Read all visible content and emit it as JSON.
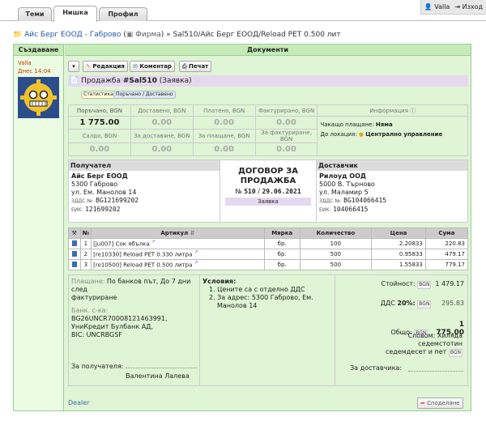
{
  "tabs": [
    "Теми",
    "Нишка",
    "Профил"
  ],
  "user": {
    "name": "Valla",
    "logout": "Изход"
  },
  "breadcrumb": {
    "company": "Айс Берг ЕООД - Габрово",
    "type": "Фирма",
    "doc": "Sal510/Айс Берг ЕООД/Reload PET 0.500 лит"
  },
  "headers": {
    "created": "Създаване",
    "documents": "Документи"
  },
  "creator": {
    "name": "Valla",
    "time": "Днес 14:04"
  },
  "toolbar": {
    "edit": "Редакция",
    "comment": "Коментар",
    "print": "Печат"
  },
  "sale": {
    "prefix": "Продажба",
    "number": "#Sal510",
    "status": "(Заявка)"
  },
  "pills": [
    "Статистика",
    "Поръчано / Доставено"
  ],
  "summary": {
    "labels_top": [
      "Поръчано, BGN",
      "Доставено, BGN",
      "Платено, BGN",
      "Фактурирано, BGN",
      "Информация"
    ],
    "values_top": [
      "1 775.00",
      "0.00",
      "0.00",
      "0.00"
    ],
    "labels_bottom": [
      "Салдо, BGN",
      "За доставяне, BGN",
      "За плащане, BGN",
      "За фактуриране, BGN"
    ],
    "values_bottom": [
      "0.00",
      "0.00",
      "0.00",
      "0.00"
    ],
    "info_payment_label": "Чакащо плащане:",
    "info_payment_value": "Няма",
    "info_location_label": "До локация:",
    "info_location_value": "Централно управление"
  },
  "recipient": {
    "head": "Получател",
    "name": "Айс Берг ЕООД",
    "addr1": "5300 Габрово",
    "addr2": "ул. Ем. Манолов 14",
    "vat_label": "ЗДДС №:",
    "vat": "BG121699202",
    "eik_label": "ЕИК:",
    "eik": "121699202"
  },
  "contract": {
    "title1": "ДОГОВОР ЗА",
    "title2": "ПРОДАЖБА",
    "no_label": "№",
    "no": "510",
    "date": "29.06.2021",
    "state": "Заявка"
  },
  "supplier": {
    "head": "Доставчик",
    "name": "Рилоуд ООД",
    "addr1": "5000 В. Търново",
    "addr2": "ул. Маламир 5",
    "vat_label": "ЗДДС №:",
    "vat": "BG104066415",
    "eik_label": "ЕИК:",
    "eik": "104066415"
  },
  "items": {
    "headers": [
      "№",
      "Артикул",
      "Мярка",
      "Количество",
      "Цена",
      "Сума"
    ],
    "rows": [
      {
        "n": "1",
        "code": "[ju007]",
        "name": "Сок ябълка",
        "unit": "бр.",
        "qty": "100",
        "price": "2.20833",
        "sum": "220.83"
      },
      {
        "n": "2",
        "code": "[re10330]",
        "name": "Reload PET 0.330 литра",
        "unit": "бр.",
        "qty": "500",
        "price": "0.95833",
        "sum": "479.17"
      },
      {
        "n": "3",
        "code": "[re10500]",
        "name": "Reload PET 0.500 литра",
        "unit": "бр.",
        "qty": "500",
        "price": "1.55833",
        "sum": "779.17"
      }
    ]
  },
  "payment": {
    "label": "Плащане:",
    "text1": "По банков път, До 7 дни след",
    "text2": "фактуриране",
    "bank_label": "Банк. с-ка:",
    "iban": "BG26UNCR70008121463991,",
    "bank": "УниКредит Булбанк АД,",
    "bic": "BIC: UNCRBGSF"
  },
  "conditions": {
    "head": "Условия:",
    "c1": "1. Цените са с отделно ДДС",
    "c2a": "2. За адрес: 5300 Габрово, Ем.",
    "c2b": "Манолов 14"
  },
  "totals": {
    "cost_label": "Стойност:",
    "cur": "BGN",
    "cost": "1 479.17",
    "vat_label": "ДДС",
    "vat_pct": "20%:",
    "vat": "295.83",
    "total_label": "Общо:",
    "total": "1 775.00",
    "words_label": "Словом:",
    "words1": "Хиляда седемстотин",
    "words2": "седемдесет и пет"
  },
  "signatures": {
    "recipient_label": "За получателя:",
    "recipient_name": "Валентина Лалева",
    "supplier_label": "За доставчика:"
  },
  "footer": {
    "dealer": "Dealer",
    "share": "Споделяне"
  }
}
